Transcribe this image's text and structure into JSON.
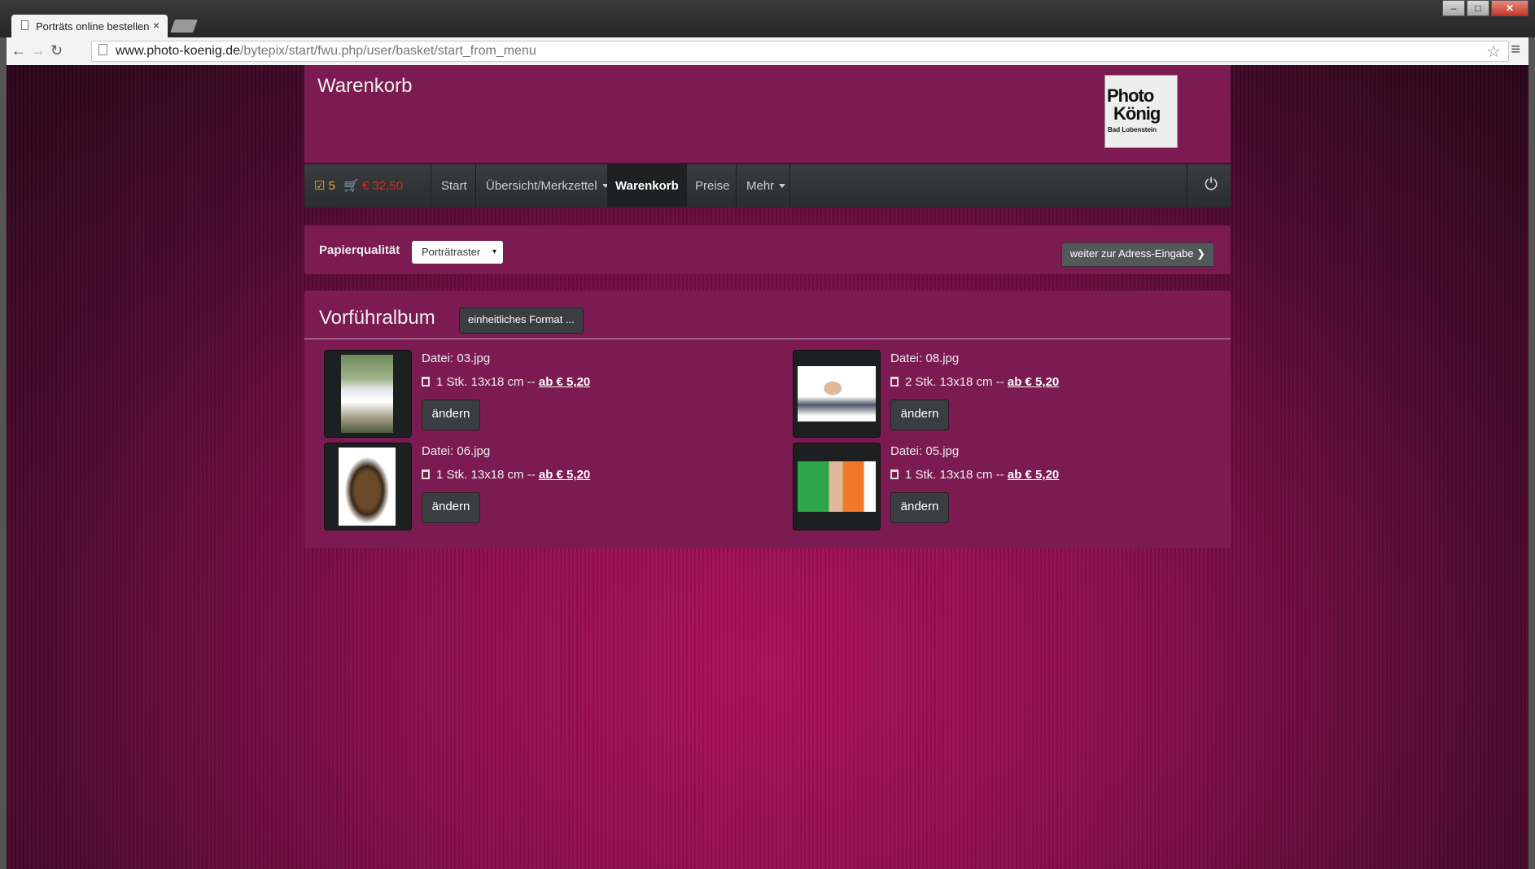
{
  "browser": {
    "tab_title": "Porträts online bestellen",
    "tab_close": "×",
    "url_host": "www.photo-koenig.de",
    "url_path": "/bytepix/start/fwu.php/user/basket/start_from_menu",
    "back_icon": "←",
    "forward_icon": "→",
    "reload_icon": "↻",
    "star_icon": "☆",
    "menu_icon": "≡",
    "minimize_icon": "–",
    "maximize_icon": "□",
    "close_icon": "✕"
  },
  "header": {
    "title": "Warenkorb",
    "logo_line1": "Photo",
    "logo_line2": "König",
    "logo_sub": "Bad Lobenstein"
  },
  "navbar": {
    "check_icon": "☑",
    "count": "5",
    "cart_icon": "🛒",
    "price": "€ 32,50",
    "items": [
      {
        "label": "Start"
      },
      {
        "label": "Übersicht/Merkzettel"
      },
      {
        "label": "Warenkorb"
      },
      {
        "label": "Preise"
      },
      {
        "label": "Mehr"
      }
    ],
    "power_icon": "⏻"
  },
  "options": {
    "paper_label": "Papierqualität",
    "paper_value": "Porträtraster",
    "select_caret": "▾",
    "next_button": "weiter zur Adress-Eingabe ❯"
  },
  "album": {
    "title": "Vorführalbum",
    "format_button": "einheitliches Format ...",
    "items": [
      {
        "file": "Datei: 03.jpg",
        "qty": "1 Stk. 13x18 cm -- ",
        "price": "ab € 5,20",
        "button": "ändern"
      },
      {
        "file": "Datei: 08.jpg",
        "qty": "2 Stk. 13x18 cm -- ",
        "price": "ab € 5,20",
        "button": "ändern"
      },
      {
        "file": "Datei: 06.jpg",
        "qty": "1 Stk. 13x18 cm -- ",
        "price": "ab € 5,20",
        "button": "ändern"
      },
      {
        "file": "Datei: 05.jpg",
        "qty": "1 Stk. 13x18 cm -- ",
        "price": "ab € 5,20",
        "button": "ändern"
      }
    ]
  },
  "colors": {
    "panel": "#7b1b52",
    "navbar": "#2e3033",
    "accent_count": "#f0a830",
    "accent_price": "#d9281d"
  }
}
